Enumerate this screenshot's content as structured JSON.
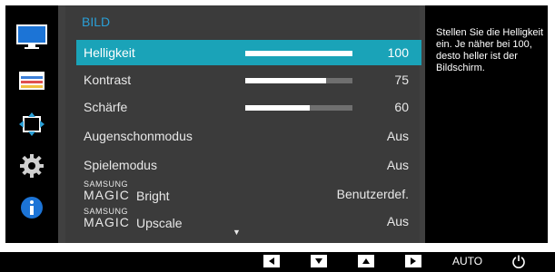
{
  "menu": {
    "title": "BILD",
    "rows": [
      {
        "label": "Helligkeit",
        "value": "100",
        "bar_fraction": 1.0
      },
      {
        "label": "Kontrast",
        "value": "75",
        "bar_fraction": 0.75
      },
      {
        "label": "Schärfe",
        "value": "60",
        "bar_fraction": 0.6
      },
      {
        "label": "Augenschonmodus",
        "value": "Aus"
      },
      {
        "label": "Spielemodus",
        "value": "Aus"
      },
      {
        "brand_top": "SAMSUNG",
        "brand_bottom": "MAGIC",
        "label": "Bright",
        "value": "Benutzerdef."
      },
      {
        "brand_top": "SAMSUNG",
        "brand_bottom": "MAGIC",
        "label": "Upscale",
        "value": "Aus"
      }
    ],
    "more_indicator": "▼"
  },
  "help": {
    "text": "Stellen Sie die Helligkeit ein. Je näher bei 100, desto heller ist der Bildschirm."
  },
  "sidebar": {
    "icons": [
      "monitor-icon",
      "color-icon",
      "size-position-icon",
      "settings-gear-icon",
      "info-icon"
    ]
  },
  "bottom_bar": {
    "buttons": [
      "left-arrow",
      "down-arrow",
      "up-arrow",
      "right-arrow"
    ],
    "auto_label": "AUTO",
    "power": "power-icon"
  },
  "colors": {
    "accent": "#1aa3b8",
    "title": "#2a9fd6",
    "panel": "#3b3b3b"
  }
}
